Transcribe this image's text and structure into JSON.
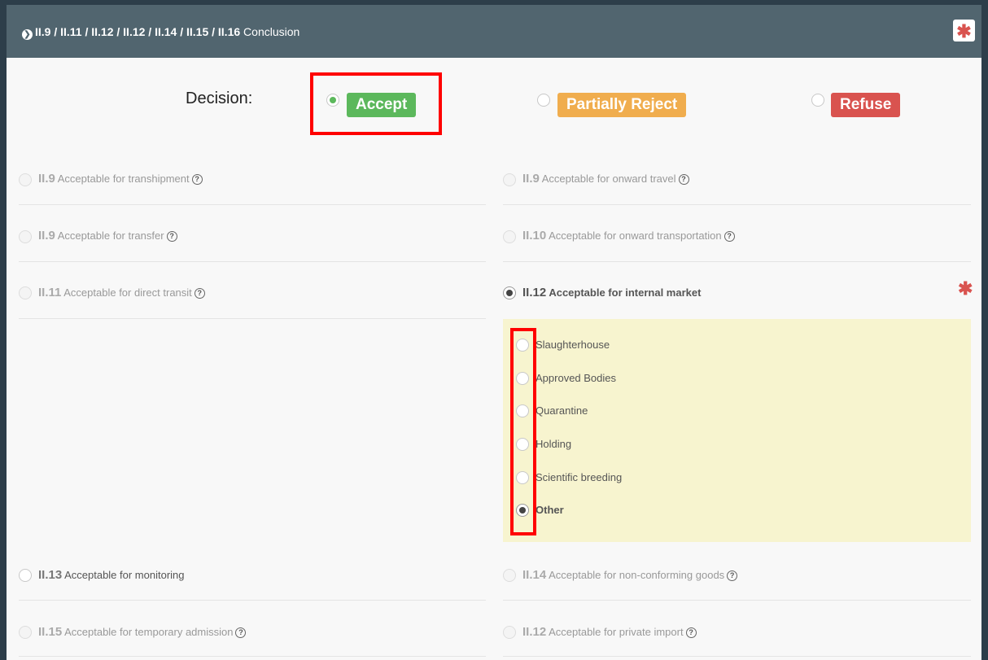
{
  "header": {
    "codes": "II.9 / II.11 / II.12 / II.12 / II.14 / II.15 / II.16",
    "title": "Conclusion",
    "required_mark": "✱"
  },
  "decision": {
    "label": "Decision:",
    "options": [
      {
        "label": "Accept",
        "selected": true,
        "color": "#5cb85c"
      },
      {
        "label": "Partially Reject",
        "selected": false,
        "color": "#f0ad4e"
      },
      {
        "label": "Refuse",
        "selected": false,
        "color": "#d9534f"
      }
    ]
  },
  "left_options": [
    {
      "code": "II.9",
      "text": "Acceptable for transhipment",
      "help": "?"
    },
    {
      "code": "II.9",
      "text": "Acceptable for transfer",
      "help": "?"
    },
    {
      "code": "II.11",
      "text": "Acceptable for direct transit",
      "help": "?"
    },
    {
      "code": "II.13",
      "text": "Acceptable for monitoring"
    },
    {
      "code": "II.15",
      "text": "Acceptable for temporary admission",
      "help": "?"
    }
  ],
  "right_options": [
    {
      "code": "II.9",
      "text": "Acceptable for onward travel",
      "help": "?"
    },
    {
      "code": "II.10",
      "text": "Acceptable for onward transportation",
      "help": "?"
    },
    {
      "code": "II.12",
      "text": "Acceptable for internal market",
      "selected": true
    },
    {
      "code": "II.14",
      "text": "Acceptable for non-conforming goods",
      "help": "?"
    },
    {
      "code": "II.12",
      "text": "Acceptable for private import",
      "help": "?"
    }
  ],
  "internal_market": {
    "required_mark": "✱",
    "sub_options": [
      {
        "label": "Slaughterhouse",
        "selected": false
      },
      {
        "label": "Approved Bodies",
        "selected": false
      },
      {
        "label": "Quarantine",
        "selected": false
      },
      {
        "label": "Holding",
        "selected": false
      },
      {
        "label": "Scientific breeding",
        "selected": false
      },
      {
        "label": "Other",
        "selected": true
      }
    ]
  }
}
